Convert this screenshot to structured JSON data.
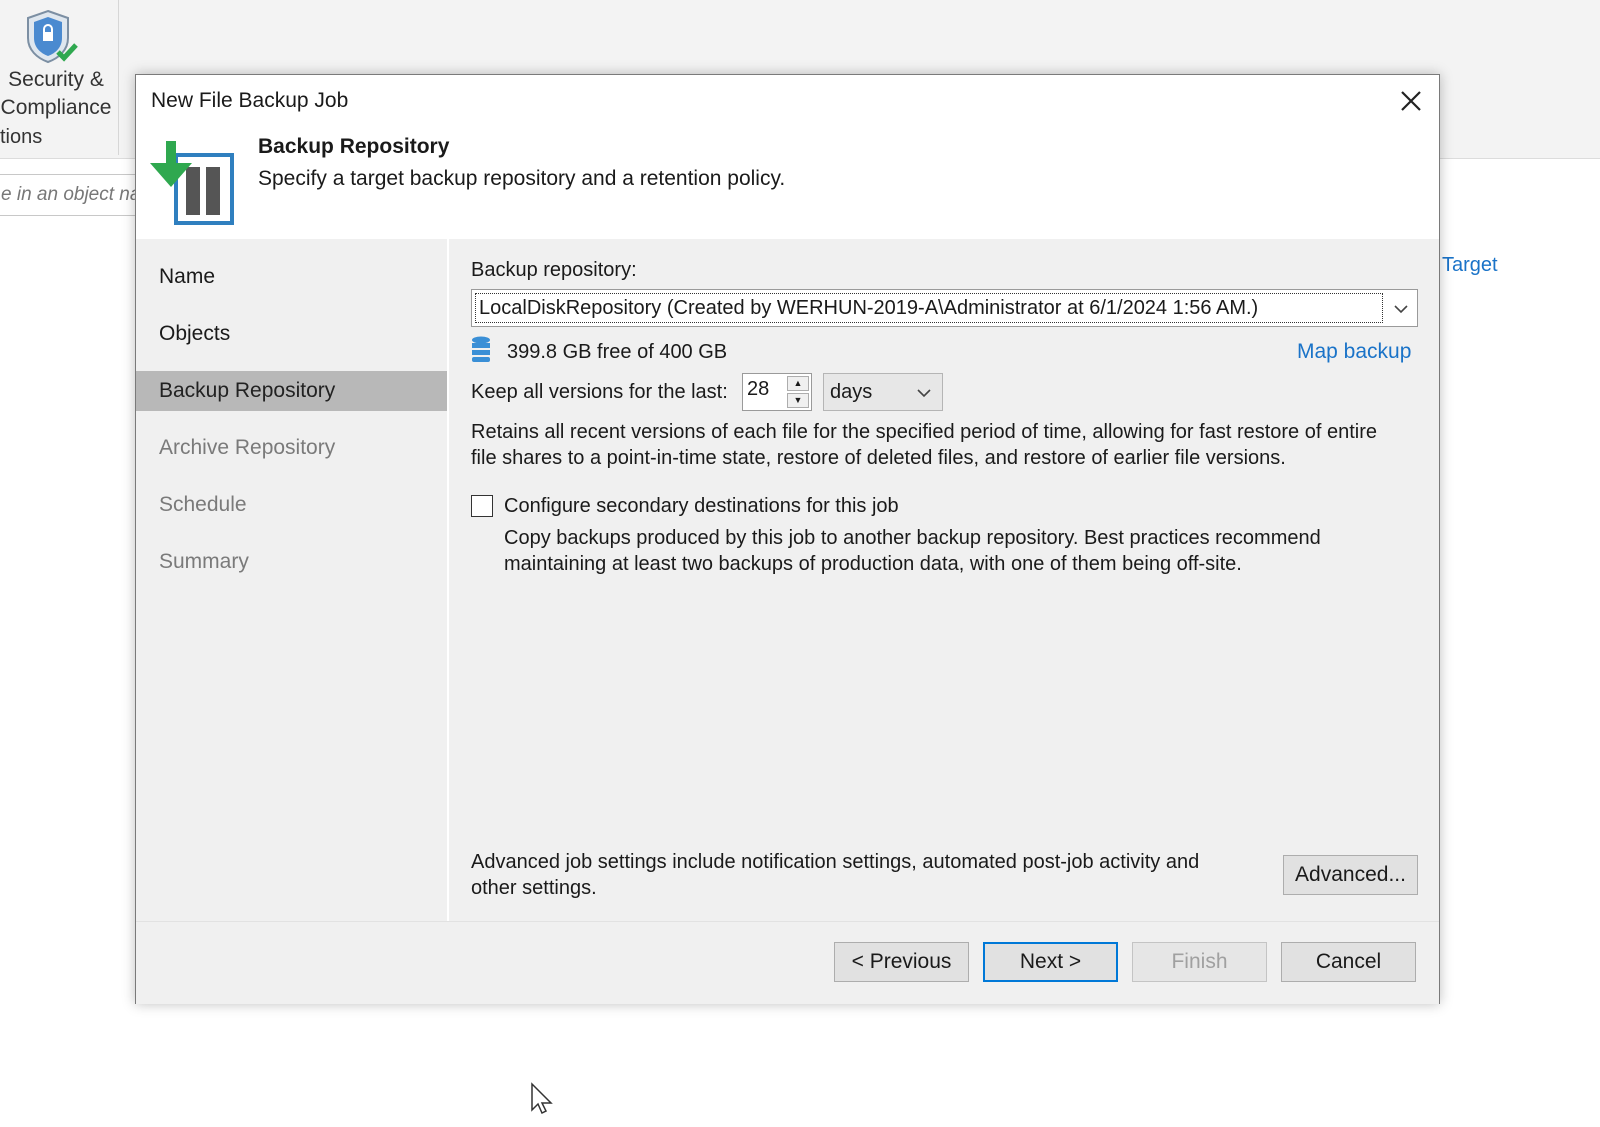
{
  "ribbon": {
    "button_label_1": "Security &",
    "button_label_2": "Compliance",
    "group_label": "tions",
    "search_placeholder": "e in an object na"
  },
  "background_link": "Target",
  "dialog": {
    "title": "New File Backup Job",
    "header_title": "Backup Repository",
    "header_subtitle": "Specify a target backup repository and a retention policy.",
    "steps": [
      {
        "label": "Name"
      },
      {
        "label": "Objects"
      },
      {
        "label": "Backup Repository"
      },
      {
        "label": "Archive Repository"
      },
      {
        "label": "Schedule"
      },
      {
        "label": "Summary"
      }
    ],
    "repository_label": "Backup repository:",
    "repository_value": "LocalDiskRepository (Created by WERHUN-2019-A\\Administrator at 6/1/2024 1:56 AM.)",
    "free_space": "399.8 GB free of 400 GB",
    "map_backup": "Map backup",
    "keep_label": "Keep all versions for the last:",
    "keep_value": "28",
    "keep_unit": "days",
    "retain_line1": "Retains all recent versions of each file for the specified period of time, allowing for fast restore of entire",
    "retain_line2": "file shares to a point-in-time state, restore of deleted files, and restore of earlier file versions.",
    "secondary_label": "Configure secondary destinations for this job",
    "secondary_checked": false,
    "secondary_line1": "Copy backups produced by this job to another backup repository. Best practices recommend",
    "secondary_line2": "maintaining at least two backups of production data, with one of them being off-site.",
    "advanced_line1": "Advanced job settings include notification settings, automated post-job activity and",
    "advanced_line2": "other settings.",
    "advanced_button": "Advanced...",
    "buttons": {
      "previous": "< Previous",
      "next": "Next >",
      "finish": "Finish",
      "cancel": "Cancel"
    }
  },
  "colors": {
    "accent": "#0078d7",
    "link": "#1a73c8",
    "nav_active": "#b8b8b8",
    "panel": "#f0f0f0"
  }
}
